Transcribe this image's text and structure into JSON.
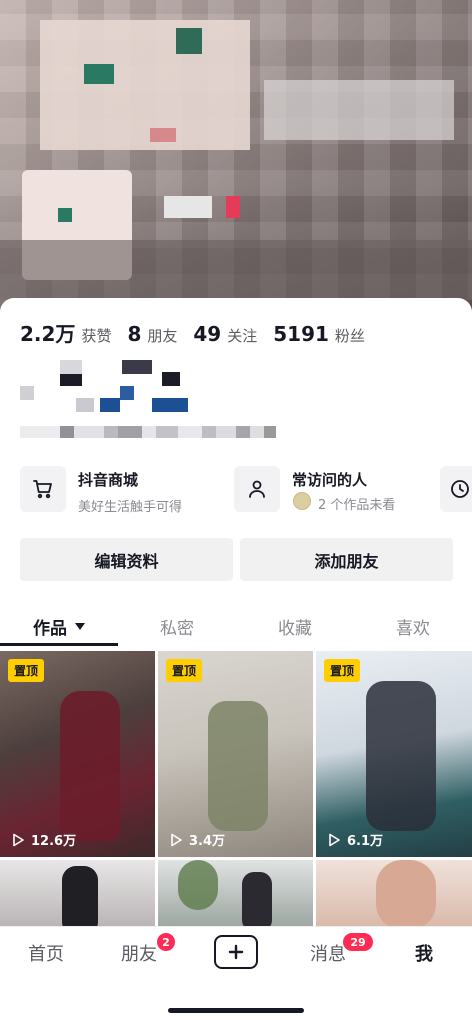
{
  "stats": [
    {
      "num": "2.2万",
      "label": "获赞"
    },
    {
      "num": "8",
      "label": "朋友"
    },
    {
      "num": "49",
      "label": "关注"
    },
    {
      "num": "5191",
      "label": "粉丝"
    }
  ],
  "cards": [
    {
      "title": "抖音商城",
      "subtitle": "美好生活触手可得",
      "icon": "cart-icon"
    },
    {
      "title": "常访问的人",
      "subtitle": "2 个作品未看",
      "icon": "person-icon"
    },
    {
      "icon": "clock-icon"
    }
  ],
  "buttons": {
    "edit_profile": "编辑资料",
    "add_friend": "添加朋友"
  },
  "tabs": [
    {
      "label": "作品",
      "active": true
    },
    {
      "label": "私密"
    },
    {
      "label": "收藏"
    },
    {
      "label": "喜欢"
    }
  ],
  "videos": [
    {
      "pinned": "置顶",
      "plays": "12.6万"
    },
    {
      "pinned": "置顶",
      "plays": "3.4万"
    },
    {
      "pinned": "置顶",
      "plays": "6.1万"
    }
  ],
  "bottom_nav": {
    "home": "首页",
    "friends": "朋友",
    "friends_badge": "2",
    "messages": "消息",
    "messages_badge": "29",
    "me": "我"
  },
  "colors": {
    "accent_red": "#fe2c55",
    "pin_yellow": "#fece00",
    "text_primary": "#161823",
    "text_secondary": "#8a8b91"
  }
}
